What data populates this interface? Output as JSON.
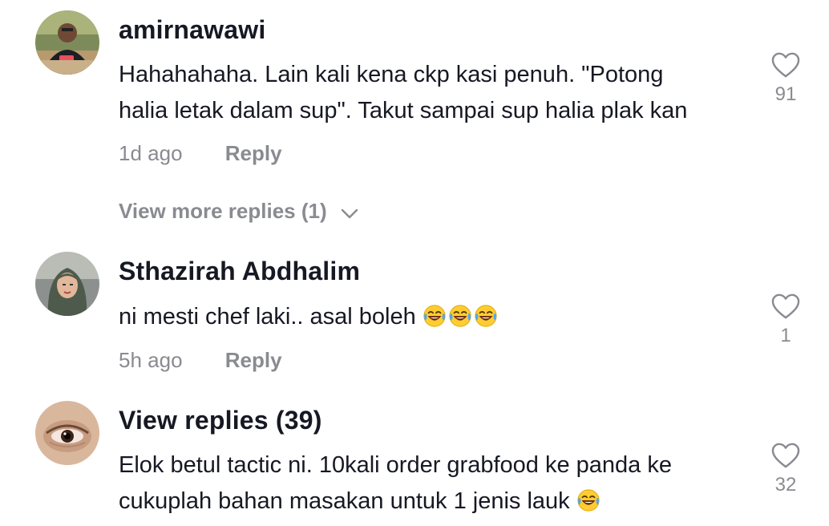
{
  "comments": [
    {
      "username": "amirnawawi",
      "text_line1": "Hahahahaha. Lain kali kena ckp kasi penuh. \"Potong",
      "text_line2": "halia letak dalam sup\". Takut sampai sup halia plak kan",
      "time": "1d ago",
      "reply_label": "Reply",
      "likes": "91",
      "view_more": "View more replies (1)"
    },
    {
      "username": "Sthazirah Abdhalim",
      "text": "ni mesti chef laki.. asal boleh ",
      "emoji": [
        "face-with-tears-of-joy",
        "face-with-tears-of-joy",
        "face-with-tears-of-joy"
      ],
      "time": "5h ago",
      "reply_label": "Reply",
      "likes": "1"
    },
    {
      "username": "View replies (39)",
      "text_line1": "Elok betul tactic ni. 10kali order grabfood ke panda ke",
      "text_line2": "cukuplah bahan masakan untuk 1 jenis lauk ",
      "emoji": [
        "face-with-tears-of-joy"
      ],
      "likes": "32"
    }
  ],
  "icons": {
    "like": "heart-outline-icon",
    "expand": "chevron-down-icon"
  },
  "colors": {
    "text": "#161823",
    "secondary": "#8a8b91",
    "background": "#ffffff"
  }
}
